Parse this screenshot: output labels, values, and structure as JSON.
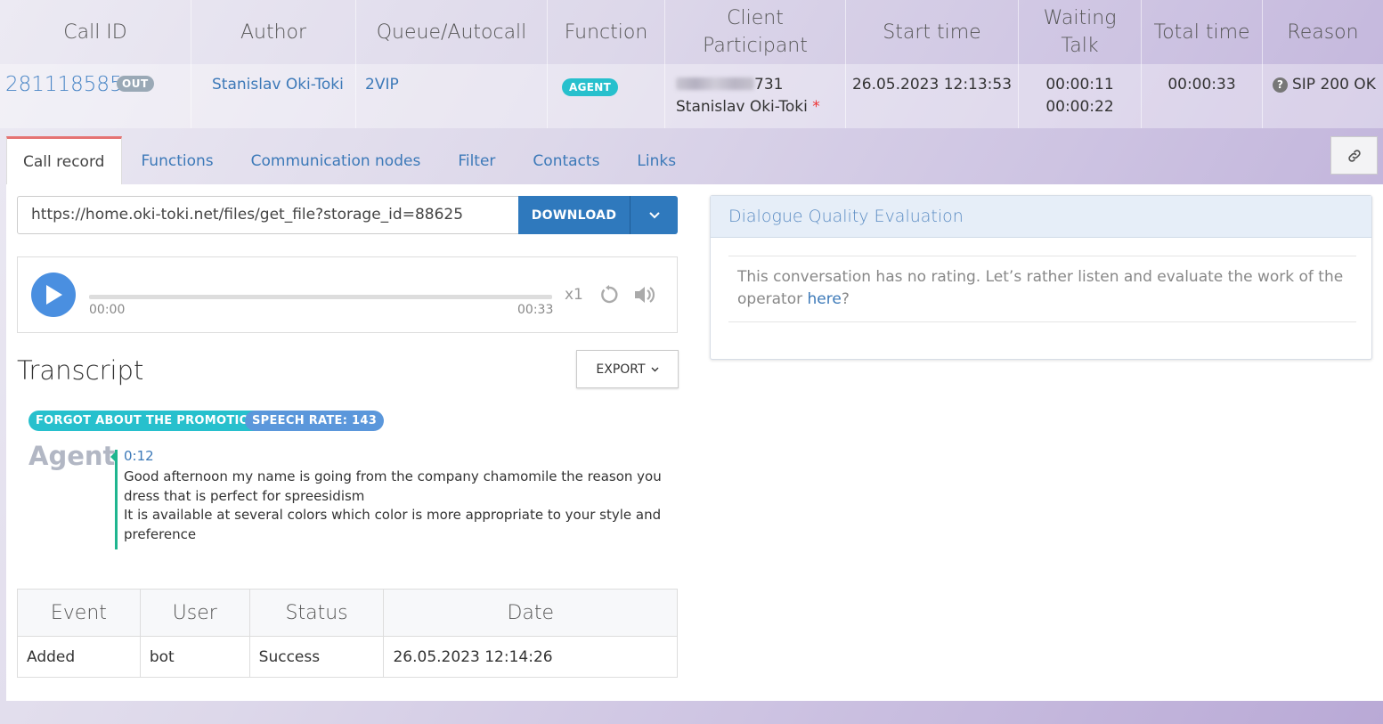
{
  "calls_table": {
    "headers": {
      "call_id": "Call ID",
      "author": "Author",
      "queue": "Queue/Autocall",
      "function": "Function",
      "client_line1": "Client",
      "client_line2": "Participant",
      "start_time": "Start time",
      "waiting_line1": "Waiting",
      "waiting_line2": "Talk",
      "total_time": "Total time",
      "reason": "Reason"
    },
    "row": {
      "call_id": "281118585",
      "direction_badge": "OUT",
      "author": "Stanislav Oki-Toki",
      "queue": "2VIP",
      "function_badge": "AGENT",
      "client_phone_suffix": "731",
      "participant": "Stanislav Oki-Toki",
      "participant_marker": "*",
      "start_time": "26.05.2023 12:13:53",
      "waiting": "00:00:11",
      "talk": "00:00:22",
      "total_time": "00:00:33",
      "reason_icon": "?",
      "reason": "SIP 200 OK"
    }
  },
  "tabs": [
    {
      "label": "Call record",
      "active": true
    },
    {
      "label": "Functions"
    },
    {
      "label": "Communication nodes"
    },
    {
      "label": "Filter"
    },
    {
      "label": "Contacts"
    },
    {
      "label": "Links"
    }
  ],
  "record": {
    "url": "https://home.oki-toki.net/files/get_file?storage_id=88625",
    "download_label": "DOWNLOAD"
  },
  "player": {
    "current_time": "00:00",
    "duration": "00:33",
    "speed": "x1",
    "progress": 0
  },
  "transcript": {
    "title": "Transcript",
    "export_label": "EXPORT",
    "tags": [
      "FORGOT ABOUT THE PROMOTION",
      "SPEECH RATE: 143"
    ],
    "speaker": "Agent",
    "time": "0:12",
    "lines": [
      "Good afternoon my name is going from the company chamomile the reason you dress that is perfect for spreesidism",
      "It is available at several colors which color is more appropriate to your style and preference"
    ]
  },
  "events_table": {
    "headers": [
      "Event",
      "User",
      "Status",
      "Date"
    ],
    "rows": [
      [
        "Added",
        "bot",
        "Success",
        "26.05.2023 12:14:26"
      ]
    ]
  },
  "quality": {
    "title": "Dialogue Quality Evaluation",
    "text": "This conversation has no rating. Let’s rather listen and evaluate the work of the operator ",
    "link": "here",
    "suffix": "?"
  },
  "colors": {
    "accent": "#2f79bd",
    "link": "#3c79b8",
    "agent_badge": "#27c0cd",
    "speech_badge": "#5b97db",
    "transcript_line": "#1fb58f"
  },
  "icons": {
    "link_button": "link-icon",
    "dropdown": "chevron-down-icon",
    "play": "play-icon",
    "replay": "replay-icon",
    "volume": "volume-icon",
    "reason": "question-circle-icon"
  }
}
